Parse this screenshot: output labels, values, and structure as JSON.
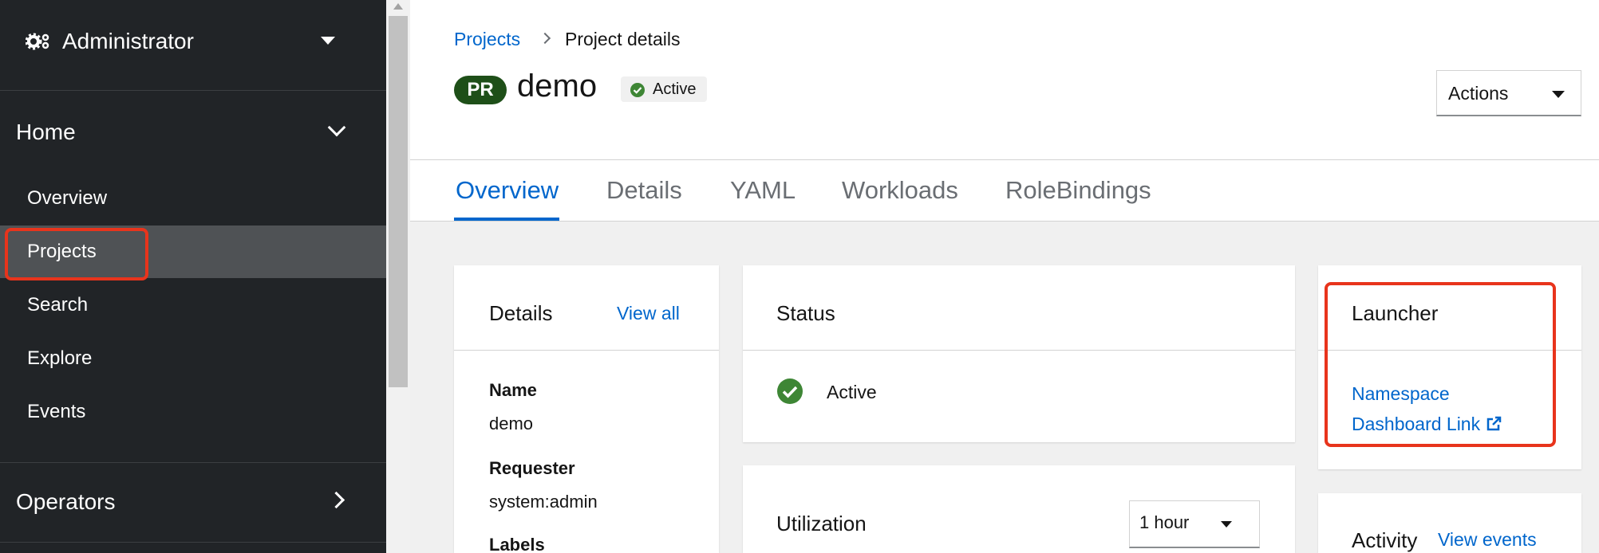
{
  "sidebar": {
    "perspective": "Administrator",
    "home_section": "Home",
    "items": [
      "Overview",
      "Projects",
      "Search",
      "Explore",
      "Events"
    ],
    "operators_section": "Operators"
  },
  "breadcrumb": {
    "link": "Projects",
    "current": "Project details"
  },
  "header": {
    "badge": "PR",
    "title": "demo",
    "status": "Active",
    "actions_label": "Actions"
  },
  "tabs": [
    "Overview",
    "Details",
    "YAML",
    "Workloads",
    "RoleBindings"
  ],
  "details_card": {
    "title": "Details",
    "view_all": "View all",
    "name_label": "Name",
    "name_value": "demo",
    "requester_label": "Requester",
    "requester_value": "system:admin",
    "labels_label": "Labels"
  },
  "status_card": {
    "title": "Status",
    "status": "Active"
  },
  "utilization_card": {
    "title": "Utilization",
    "duration": "1 hour"
  },
  "launcher_card": {
    "title": "Launcher",
    "link_line1": "Namespace",
    "link_line2": "Dashboard Link"
  },
  "activity_card": {
    "title": "Activity",
    "view_events": "View events"
  },
  "colors": {
    "sidebar_bg": "#212427",
    "active_nav_bg": "#4f5255",
    "link_blue": "#0066cc",
    "badge_green": "#1e4f18",
    "status_green": "#3e8635",
    "highlight_red": "#e8341c"
  }
}
